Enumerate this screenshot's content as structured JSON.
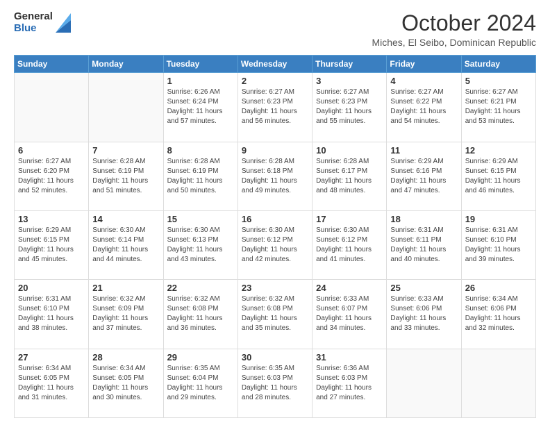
{
  "logo": {
    "general": "General",
    "blue": "Blue"
  },
  "title": "October 2024",
  "subtitle": "Miches, El Seibo, Dominican Republic",
  "calendar": {
    "headers": [
      "Sunday",
      "Monday",
      "Tuesday",
      "Wednesday",
      "Thursday",
      "Friday",
      "Saturday"
    ],
    "weeks": [
      [
        {
          "day": "",
          "info": ""
        },
        {
          "day": "",
          "info": ""
        },
        {
          "day": "1",
          "info": "Sunrise: 6:26 AM\nSunset: 6:24 PM\nDaylight: 11 hours and 57 minutes."
        },
        {
          "day": "2",
          "info": "Sunrise: 6:27 AM\nSunset: 6:23 PM\nDaylight: 11 hours and 56 minutes."
        },
        {
          "day": "3",
          "info": "Sunrise: 6:27 AM\nSunset: 6:23 PM\nDaylight: 11 hours and 55 minutes."
        },
        {
          "day": "4",
          "info": "Sunrise: 6:27 AM\nSunset: 6:22 PM\nDaylight: 11 hours and 54 minutes."
        },
        {
          "day": "5",
          "info": "Sunrise: 6:27 AM\nSunset: 6:21 PM\nDaylight: 11 hours and 53 minutes."
        }
      ],
      [
        {
          "day": "6",
          "info": "Sunrise: 6:27 AM\nSunset: 6:20 PM\nDaylight: 11 hours and 52 minutes."
        },
        {
          "day": "7",
          "info": "Sunrise: 6:28 AM\nSunset: 6:19 PM\nDaylight: 11 hours and 51 minutes."
        },
        {
          "day": "8",
          "info": "Sunrise: 6:28 AM\nSunset: 6:19 PM\nDaylight: 11 hours and 50 minutes."
        },
        {
          "day": "9",
          "info": "Sunrise: 6:28 AM\nSunset: 6:18 PM\nDaylight: 11 hours and 49 minutes."
        },
        {
          "day": "10",
          "info": "Sunrise: 6:28 AM\nSunset: 6:17 PM\nDaylight: 11 hours and 48 minutes."
        },
        {
          "day": "11",
          "info": "Sunrise: 6:29 AM\nSunset: 6:16 PM\nDaylight: 11 hours and 47 minutes."
        },
        {
          "day": "12",
          "info": "Sunrise: 6:29 AM\nSunset: 6:15 PM\nDaylight: 11 hours and 46 minutes."
        }
      ],
      [
        {
          "day": "13",
          "info": "Sunrise: 6:29 AM\nSunset: 6:15 PM\nDaylight: 11 hours and 45 minutes."
        },
        {
          "day": "14",
          "info": "Sunrise: 6:30 AM\nSunset: 6:14 PM\nDaylight: 11 hours and 44 minutes."
        },
        {
          "day": "15",
          "info": "Sunrise: 6:30 AM\nSunset: 6:13 PM\nDaylight: 11 hours and 43 minutes."
        },
        {
          "day": "16",
          "info": "Sunrise: 6:30 AM\nSunset: 6:12 PM\nDaylight: 11 hours and 42 minutes."
        },
        {
          "day": "17",
          "info": "Sunrise: 6:30 AM\nSunset: 6:12 PM\nDaylight: 11 hours and 41 minutes."
        },
        {
          "day": "18",
          "info": "Sunrise: 6:31 AM\nSunset: 6:11 PM\nDaylight: 11 hours and 40 minutes."
        },
        {
          "day": "19",
          "info": "Sunrise: 6:31 AM\nSunset: 6:10 PM\nDaylight: 11 hours and 39 minutes."
        }
      ],
      [
        {
          "day": "20",
          "info": "Sunrise: 6:31 AM\nSunset: 6:10 PM\nDaylight: 11 hours and 38 minutes."
        },
        {
          "day": "21",
          "info": "Sunrise: 6:32 AM\nSunset: 6:09 PM\nDaylight: 11 hours and 37 minutes."
        },
        {
          "day": "22",
          "info": "Sunrise: 6:32 AM\nSunset: 6:08 PM\nDaylight: 11 hours and 36 minutes."
        },
        {
          "day": "23",
          "info": "Sunrise: 6:32 AM\nSunset: 6:08 PM\nDaylight: 11 hours and 35 minutes."
        },
        {
          "day": "24",
          "info": "Sunrise: 6:33 AM\nSunset: 6:07 PM\nDaylight: 11 hours and 34 minutes."
        },
        {
          "day": "25",
          "info": "Sunrise: 6:33 AM\nSunset: 6:06 PM\nDaylight: 11 hours and 33 minutes."
        },
        {
          "day": "26",
          "info": "Sunrise: 6:34 AM\nSunset: 6:06 PM\nDaylight: 11 hours and 32 minutes."
        }
      ],
      [
        {
          "day": "27",
          "info": "Sunrise: 6:34 AM\nSunset: 6:05 PM\nDaylight: 11 hours and 31 minutes."
        },
        {
          "day": "28",
          "info": "Sunrise: 6:34 AM\nSunset: 6:05 PM\nDaylight: 11 hours and 30 minutes."
        },
        {
          "day": "29",
          "info": "Sunrise: 6:35 AM\nSunset: 6:04 PM\nDaylight: 11 hours and 29 minutes."
        },
        {
          "day": "30",
          "info": "Sunrise: 6:35 AM\nSunset: 6:03 PM\nDaylight: 11 hours and 28 minutes."
        },
        {
          "day": "31",
          "info": "Sunrise: 6:36 AM\nSunset: 6:03 PM\nDaylight: 11 hours and 27 minutes."
        },
        {
          "day": "",
          "info": ""
        },
        {
          "day": "",
          "info": ""
        }
      ]
    ]
  }
}
